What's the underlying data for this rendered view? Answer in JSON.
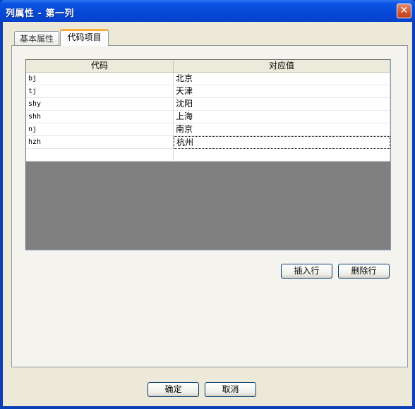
{
  "window": {
    "title": "列属性 - 第一列",
    "close_glyph": "✕"
  },
  "tabs": [
    {
      "label": "基本属性",
      "selected": false
    },
    {
      "label": "代码项目",
      "selected": true
    }
  ],
  "table": {
    "columns": [
      "代码",
      "对应值"
    ],
    "rows": [
      {
        "code": "bj",
        "value": "北京"
      },
      {
        "code": "tj",
        "value": "天津"
      },
      {
        "code": "shy",
        "value": "沈阳"
      },
      {
        "code": "shh",
        "value": "上海"
      },
      {
        "code": "nj",
        "value": "南京"
      },
      {
        "code": "hzh",
        "value": "杭州"
      },
      {
        "code": "",
        "value": ""
      }
    ]
  },
  "buttons": {
    "insert_row": "插入行",
    "delete_row": "删除行",
    "ok": "确定",
    "cancel": "取消"
  },
  "colors": {
    "titlebar": "#0548d6",
    "dialog_bg": "#ece9d8",
    "selected_tab_accent": "#f8b03b",
    "table_empty_area": "#808080"
  }
}
